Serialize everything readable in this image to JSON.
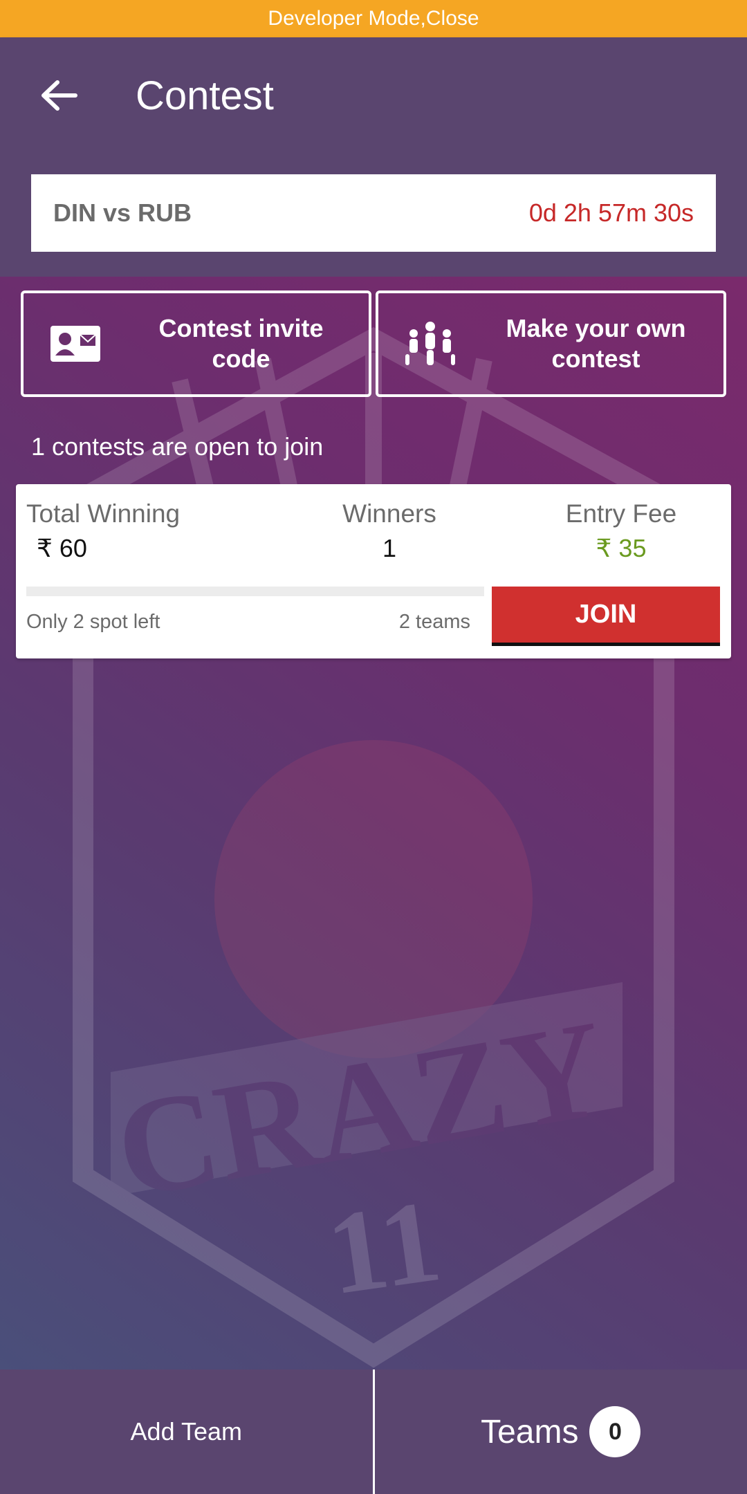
{
  "developer_bar": {
    "text": "Developer Mode,Close"
  },
  "app_bar": {
    "title": "Contest",
    "back_icon": "arrow-left-icon"
  },
  "match": {
    "teams": "DIN vs RUB",
    "countdown": "0d 2h 57m 30s"
  },
  "actions": {
    "invite_label": "Contest invite code",
    "invite_icon": "contact-card-icon",
    "own_label": "Make your own contest",
    "own_icon": "group-people-icon"
  },
  "contests_open_text": "1 contests are open to join",
  "contest": {
    "total_winning_label": "Total Winning",
    "total_winning_value": "₹ 60",
    "winners_label": "Winners",
    "winners_value": "1",
    "entry_fee_label": "Entry Fee",
    "entry_fee_value": "₹ 35",
    "spots_left_text": "Only 2 spot left",
    "teams_text": "2 teams",
    "join_label": "JOIN",
    "filled_fraction": 0.0
  },
  "watermark": {
    "brand_text": "CRAZY",
    "brand_number": "11"
  },
  "bottom_bar": {
    "add_team_label": "Add Team",
    "teams_label": "Teams",
    "teams_count": "0"
  },
  "colors": {
    "accent": "#f5a623",
    "timer": "#c62828",
    "entry_fee": "#6a9a1f",
    "join": "#d0302f",
    "bar": "#5a456f"
  }
}
